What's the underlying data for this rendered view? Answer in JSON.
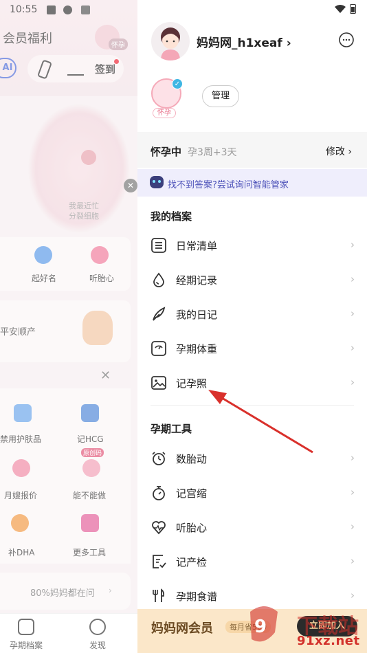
{
  "status_bar": {
    "time": "10:55"
  },
  "background_app": {
    "title": "会员福利",
    "avatar_tag": "怀孕",
    "ai_label": "AI",
    "sign_label": "签到",
    "baby_tip_line1": "我最近忙",
    "baby_tip_line2": "分裂细胞",
    "tools_row1": [
      "起好名",
      "听胎心"
    ],
    "wish_text": "平安顺产",
    "tools_grid": [
      "禁用护肤品",
      "记HCG",
      "月嫂报价",
      "能不能做",
      "补DHA",
      "更多工具"
    ],
    "hot_badge": "原创码",
    "more_questions": "80%妈妈都在问",
    "nav": [
      "孕期档案",
      "发现"
    ]
  },
  "drawer": {
    "username": "妈妈网_h1xeaf",
    "baby_tag": "怀孕",
    "manage_label": "管理",
    "pregnancy": {
      "status": "怀孕中",
      "week": "孕3周+3天",
      "edit_label": "修改"
    },
    "ai_banner": "找不到答案?尝试询问智能管家",
    "sections": [
      {
        "title": "我的档案",
        "items": [
          {
            "label": "日常清单",
            "icon": "list-icon"
          },
          {
            "label": "经期记录",
            "icon": "drop-icon"
          },
          {
            "label": "我的日记",
            "icon": "feather-icon"
          },
          {
            "label": "孕期体重",
            "icon": "scale-icon"
          },
          {
            "label": "记孕照",
            "icon": "photo-icon"
          }
        ]
      },
      {
        "title": "孕期工具",
        "items": [
          {
            "label": "数胎动",
            "icon": "alarm-icon"
          },
          {
            "label": "记宫缩",
            "icon": "stopwatch-icon"
          },
          {
            "label": "听胎心",
            "icon": "heartbeat-icon"
          },
          {
            "label": "记产检",
            "icon": "checklist-icon"
          },
          {
            "label": "孕期食谱",
            "icon": "cutlery-icon"
          }
        ]
      }
    ],
    "member": {
      "title": "妈妈网会员",
      "tag": "每月省500",
      "join_label": "立即加入"
    }
  },
  "watermark": {
    "site": "91xz.net",
    "cn": "下载站"
  },
  "colors": {
    "accent_pink": "#e8708a",
    "ai_blue": "#4a4fb8",
    "arrow_red": "#d9302b",
    "member_gold": "#fbe7c9"
  }
}
